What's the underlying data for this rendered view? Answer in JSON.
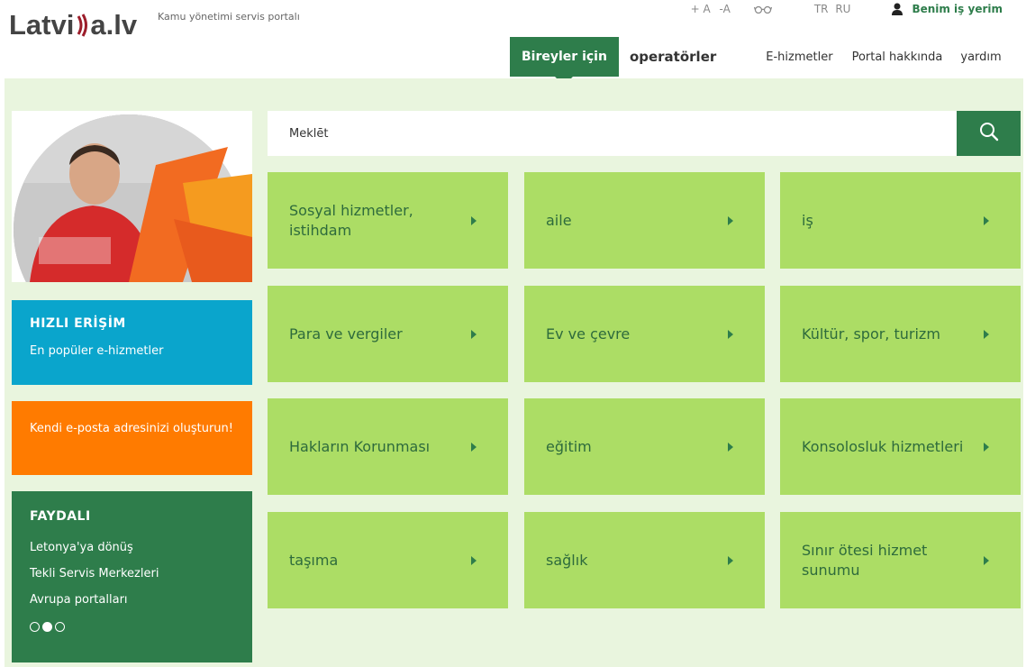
{
  "header": {
    "logo": {
      "left": "Latvi",
      "right": "a.lv"
    },
    "tagline": "Kamu yönetimi servis portalı",
    "font_size": [
      "+ A",
      "-A"
    ],
    "glasses_icon": "glasses-icon",
    "languages": [
      "TR",
      "RU"
    ],
    "user_label": "Benim iş yerim"
  },
  "nav": {
    "active": "Bireyler için",
    "operators": "operatörler",
    "eservices": "E-hizmetler",
    "about": "Portal hakkında",
    "help": "yardım"
  },
  "search": {
    "placeholder": "Meklēt"
  },
  "quick": {
    "title": "HIZLI ERİŞİM",
    "subtitle": "En popüler e-hizmetler"
  },
  "email": {
    "text": "Kendi e-posta adresinizi oluşturun!"
  },
  "useful": {
    "title": "FAYDALI",
    "links": [
      "Letonya'ya dönüş",
      "Tekli Servis Merkezleri",
      "Avrupa portalları"
    ]
  },
  "tiles": [
    "Sosyal hizmetler, istihdam",
    "aile",
    "iş",
    "Para ve vergiler",
    "Ev ve çevre",
    "Kültür, spor, turizm",
    "Hakların Korunması",
    "eğitim",
    "Konsolosluk hizmetleri",
    "taşıma",
    "sağlık",
    "Sınır ötesi hizmet sunumu"
  ],
  "colors": {
    "green_dark": "#2e7d4b",
    "tile_green": "#acdd65",
    "bg_green": "#e9f5de",
    "blue": "#0aa5cc",
    "orange": "#ff7b00"
  }
}
